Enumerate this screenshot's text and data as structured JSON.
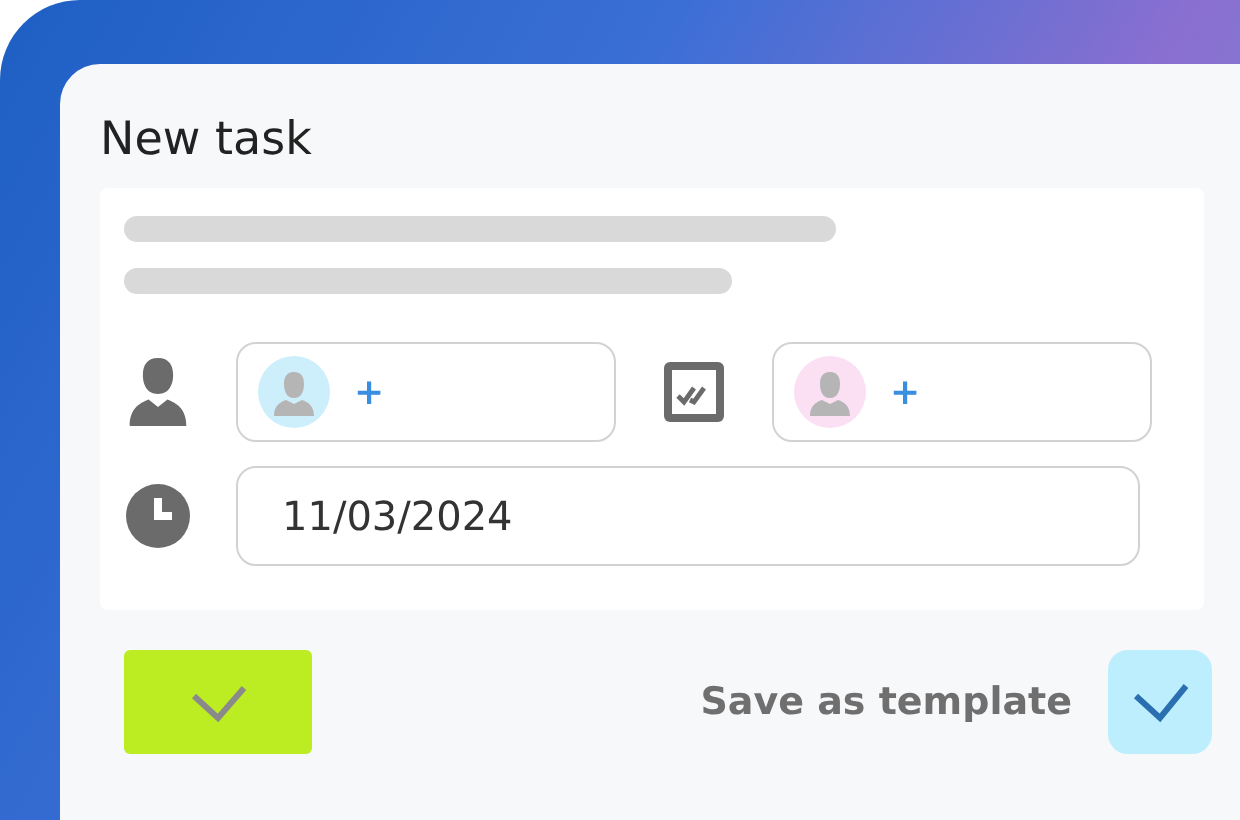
{
  "dialog": {
    "title": "New task"
  },
  "assignees": [
    {
      "kind": "person",
      "add_label": "+",
      "color": "#cdeefb"
    },
    {
      "kind": "checker",
      "add_label": "+",
      "color": "#fbe0f3"
    }
  ],
  "due_date": {
    "value": "11/03/2024"
  },
  "save_as_template": {
    "label": "Save as template",
    "checked": true
  }
}
